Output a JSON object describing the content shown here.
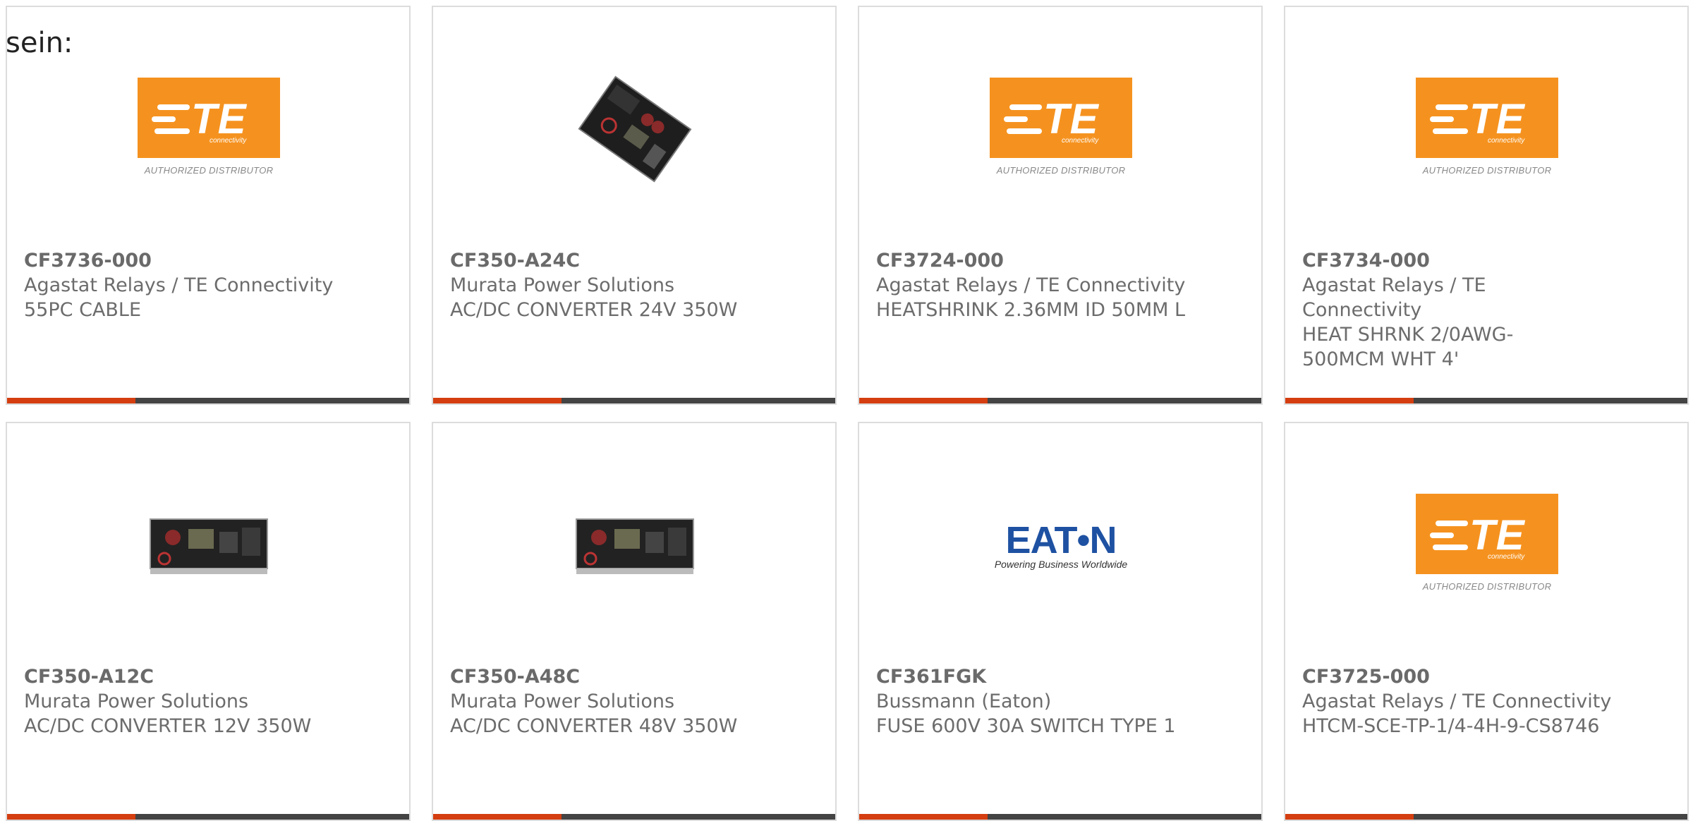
{
  "intro_text": "sein:",
  "te_logo": {
    "letters": "TE",
    "sub": "connectivity",
    "authorized": "AUTHORIZED DISTRIBUTOR",
    "color": "#f5921f"
  },
  "eaton_logo": {
    "word": "EAT•N",
    "tagline": "Powering Business Worldwide",
    "color": "#1e51a2"
  },
  "accent_color": "#d43e10",
  "products": [
    {
      "part": "CF3736-000",
      "maker": "Agastat Relays / TE Connectivity",
      "desc": "55PC CABLE",
      "image": "te-logo"
    },
    {
      "part": "CF350-A24C",
      "maker": "Murata Power Solutions",
      "desc": "AC/DC CONVERTER 24V 350W",
      "image": "power-supply-board"
    },
    {
      "part": "CF3724-000",
      "maker": "Agastat Relays / TE Connectivity",
      "desc": "HEATSHRINK 2.36MM ID 50MM L",
      "image": "te-logo"
    },
    {
      "part": "CF3734-000",
      "maker": "Agastat Relays / TE Connectivity",
      "desc": "HEAT SHRNK 2/0AWG-500MCM WHT 4'",
      "image": "te-logo"
    },
    {
      "part": "CF350-A12C",
      "maker": "Murata Power Solutions",
      "desc": "AC/DC CONVERTER 12V 350W",
      "image": "power-supply-board"
    },
    {
      "part": "CF350-A48C",
      "maker": "Murata Power Solutions",
      "desc": "AC/DC CONVERTER 48V 350W",
      "image": "power-supply-board"
    },
    {
      "part": "CF361FGK",
      "maker": "Bussmann (Eaton)",
      "desc": "FUSE 600V 30A SWITCH TYPE 1",
      "image": "eaton-logo"
    },
    {
      "part": "CF3725-000",
      "maker": "Agastat Relays / TE Connectivity",
      "desc": "HTCM-SCE-TP-1/4-4H-9-CS8746",
      "image": "te-logo"
    }
  ]
}
